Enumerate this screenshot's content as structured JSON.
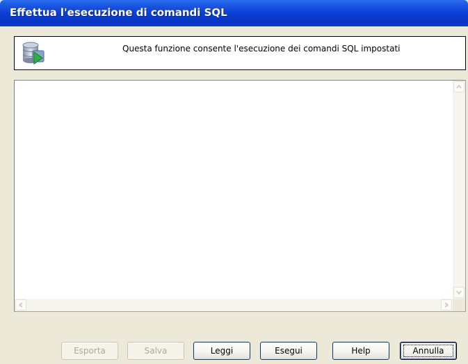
{
  "window": {
    "title": "Effettua l'esecuzione di comandi SQL"
  },
  "header": {
    "icon": "database-run-icon",
    "description": "Questa funzione consente l'esecuzione dei comandi SQL impostati"
  },
  "editor": {
    "content": ""
  },
  "buttons": {
    "esporta": "Esporta",
    "salva": "Salva",
    "leggi": "Leggi",
    "esegui": "Esegui",
    "help": "Help",
    "annulla": "Annulla"
  },
  "colors": {
    "title_bar": "#0a3fd3",
    "dialog_background": "#ece9d8",
    "button_border": "#003c74",
    "disabled_text": "#aca899"
  }
}
